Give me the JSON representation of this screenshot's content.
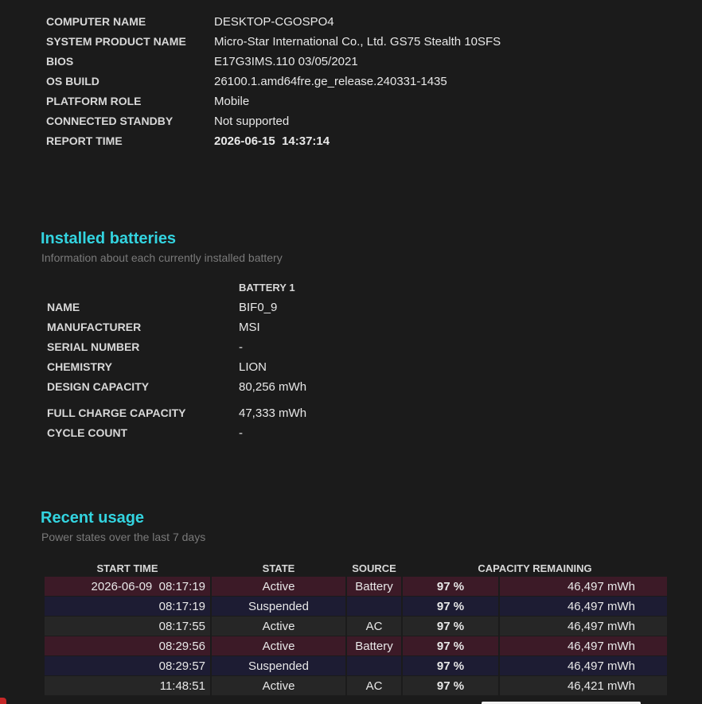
{
  "system": {
    "rows": [
      {
        "key": "COMPUTER NAME",
        "value": "DESKTOP-CGOSPO4"
      },
      {
        "key": "SYSTEM PRODUCT NAME",
        "value": "Micro-Star International Co., Ltd. GS75 Stealth 10SFS"
      },
      {
        "key": "BIOS",
        "value": "E17G3IMS.110 03/05/2021"
      },
      {
        "key": "OS BUILD",
        "value": "26100.1.amd64fre.ge_release.240331-1435"
      },
      {
        "key": "PLATFORM ROLE",
        "value": "Mobile"
      },
      {
        "key": "CONNECTED STANDBY",
        "value": "Not supported"
      },
      {
        "key": "REPORT TIME",
        "value": "2026-06-15  14:37:14"
      }
    ]
  },
  "installed": {
    "title": "Installed batteries",
    "subtitle": "Information about each currently installed battery",
    "column_header": "BATTERY 1",
    "rows": [
      {
        "key": "NAME",
        "value": "BIF0_9"
      },
      {
        "key": "MANUFACTURER",
        "value": "MSI"
      },
      {
        "key": "SERIAL NUMBER",
        "value": "-"
      },
      {
        "key": "CHEMISTRY",
        "value": "LION"
      },
      {
        "key": "DESIGN CAPACITY",
        "value": "80,256 mWh"
      },
      {
        "key": "FULL CHARGE CAPACITY",
        "value": "47,333 mWh"
      },
      {
        "key": "CYCLE COUNT",
        "value": "-"
      }
    ]
  },
  "recent": {
    "title": "Recent usage",
    "subtitle": "Power states over the last 7 days",
    "headers": [
      "START TIME",
      "STATE",
      "SOURCE",
      "CAPACITY REMAINING"
    ],
    "rows": [
      {
        "time": "2026-06-09  08:17:19",
        "state": "Active",
        "source": "Battery",
        "pct": "97 %",
        "cap": "46,497 mWh"
      },
      {
        "time": "08:17:19",
        "state": "Suspended",
        "source": "",
        "pct": "97 %",
        "cap": "46,497 mWh"
      },
      {
        "time": "08:17:55",
        "state": "Active",
        "source": "AC",
        "pct": "97 %",
        "cap": "46,497 mWh"
      },
      {
        "time": "08:29:56",
        "state": "Active",
        "source": "Battery",
        "pct": "97 %",
        "cap": "46,497 mWh"
      },
      {
        "time": "08:29:57",
        "state": "Suspended",
        "source": "",
        "pct": "97 %",
        "cap": "46,497 mWh"
      },
      {
        "time": "11:48:51",
        "state": "Active",
        "source": "AC",
        "pct": "97 %",
        "cap": "46,421 mWh"
      }
    ]
  },
  "colors": {
    "accent": "#33d4e0",
    "battery_row": "#3c1a27",
    "suspended_row": "#1d1c33",
    "ac_row": "#262626"
  }
}
